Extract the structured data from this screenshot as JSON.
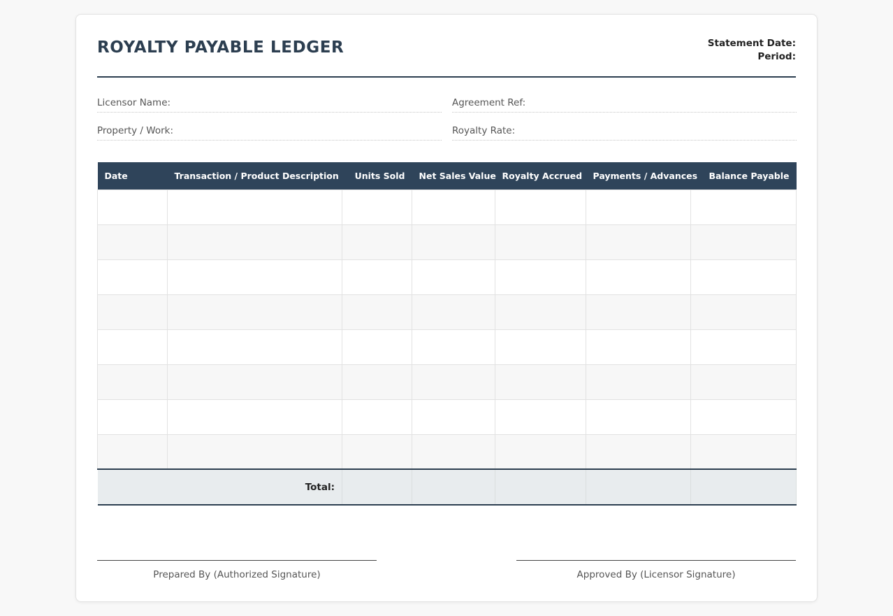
{
  "header": {
    "title": "ROYALTY PAYABLE LEDGER",
    "statement_date_label": "Statement Date:",
    "period_label": "Period:"
  },
  "fields": {
    "licensor_name": "Licensor Name:",
    "agreement_ref": "Agreement Ref:",
    "property_work": "Property / Work:",
    "royalty_rate": "Royalty Rate:"
  },
  "table": {
    "columns": [
      "Date",
      "Transaction / Product Description",
      "Units Sold",
      "Net Sales Value",
      "Royalty Accrued",
      "Payments / Advances",
      "Balance Payable"
    ],
    "row_count": 8,
    "total_label": "Total:"
  },
  "signatures": {
    "prepared_by": "Prepared By (Authorized Signature)",
    "approved_by": "Approved By (Licensor Signature)"
  },
  "colors": {
    "primary": "#2c3e50",
    "header_bg": "#2f445a",
    "total_bg": "#e8ecee",
    "stripe_bg": "#f7f7f7"
  }
}
